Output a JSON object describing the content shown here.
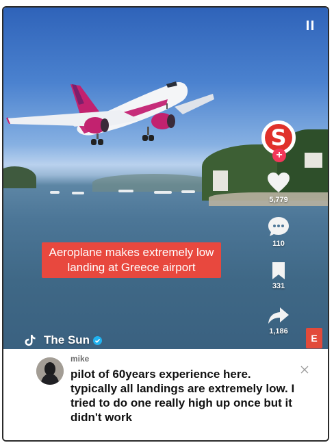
{
  "video": {
    "caption": "Aeroplane makes extremely low landing at Greece airport",
    "actions": {
      "likes": "5,779",
      "comments": "110",
      "saves": "331",
      "shares": "1,186"
    },
    "account": "The Sun",
    "logo_letter": "S",
    "side_badge": "E",
    "icons": [
      "menu-icon",
      "heart-icon",
      "comment-icon",
      "bookmark-icon",
      "share-icon",
      "tiktok-icon",
      "verified-icon",
      "close-icon"
    ]
  },
  "comment": {
    "username": "mike",
    "text": "pilot of 60years experience here. typically all landings are extremely low. I tried to do one really high up once but it didn't work"
  },
  "colors": {
    "caption_bg": "#e8483e",
    "logo_red": "#e0312b",
    "verified": "#20b2f0",
    "follow": "#f2375a"
  }
}
